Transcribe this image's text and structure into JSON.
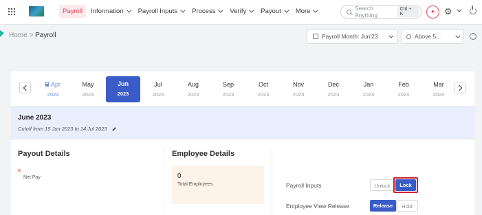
{
  "nav": {
    "items": [
      {
        "label": "Payroll",
        "has_menu": false,
        "active": true
      },
      {
        "label": "Information",
        "has_menu": true
      },
      {
        "label": "Payroll Inputs",
        "has_menu": true
      },
      {
        "label": "Process",
        "has_menu": true
      },
      {
        "label": "Verify",
        "has_menu": true
      },
      {
        "label": "Payout",
        "has_menu": true
      },
      {
        "label": "More",
        "has_menu": true
      }
    ],
    "search_placeholder": "Search Anything",
    "search_shortcut": "Ctrl + K"
  },
  "breadcrumb": {
    "home": "Home",
    "separator": ">",
    "current": "Payroll"
  },
  "filters": {
    "payroll_month": "Payroll Month:  Jun'23",
    "employee_filter": "Above 5..."
  },
  "months": [
    {
      "month": "Apr",
      "year": "2023",
      "state": "locked"
    },
    {
      "month": "May",
      "year": "2023",
      "state": "normal"
    },
    {
      "month": "Jun",
      "year": "2023",
      "state": "active"
    },
    {
      "month": "Jul",
      "year": "2023",
      "state": "normal"
    },
    {
      "month": "Aug",
      "year": "2023",
      "state": "normal"
    },
    {
      "month": "Sep",
      "year": "2023",
      "state": "normal"
    },
    {
      "month": "Oct",
      "year": "2023",
      "state": "normal"
    },
    {
      "month": "Nov",
      "year": "2023",
      "state": "normal"
    },
    {
      "month": "Dec",
      "year": "2023",
      "state": "normal"
    },
    {
      "month": "Jan",
      "year": "2024",
      "state": "normal"
    },
    {
      "month": "Feb",
      "year": "2024",
      "state": "normal"
    },
    {
      "month": "Mar",
      "year": "2024",
      "state": "normal"
    }
  ],
  "period": {
    "title": "June 2023",
    "cutoff": "Cutoff from 15 Jun 2023 to 14 Jul 2023"
  },
  "payout": {
    "title": "Payout Details",
    "legend_label": "Net Pay"
  },
  "employee": {
    "title": "Employee Details",
    "count": "0",
    "count_label": "Total Employees"
  },
  "actions": {
    "payroll_inputs_label": "Payroll Inputs",
    "unlock_label": "Unlock",
    "lock_label": "Lock",
    "employee_view_label": "Employee View Release",
    "release_label": "Release",
    "hold_label": "Hold"
  },
  "colors": {
    "brand": "#e14656",
    "primary": "#3a5cc9",
    "highlight_border": "#d0202c"
  }
}
